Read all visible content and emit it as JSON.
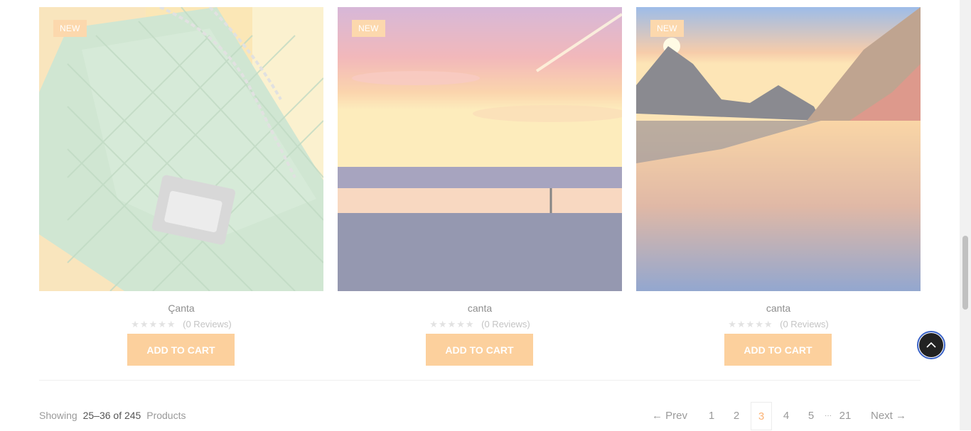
{
  "products": [
    {
      "badge": "NEW",
      "name": "Çanta",
      "reviews": "(0 Reviews)",
      "cart_label": "ADD TO CART",
      "image": "green-quilted-bag"
    },
    {
      "badge": "NEW",
      "name": "canta",
      "reviews": "(0 Reviews)",
      "cart_label": "ADD TO CART",
      "image": "sunset-sea"
    },
    {
      "badge": "NEW",
      "name": "canta",
      "reviews": "(0 Reviews)",
      "cart_label": "ADD TO CART",
      "image": "mountain-lake-sunset"
    }
  ],
  "stars": "★★★★★",
  "showing": {
    "prefix": "Showing",
    "range": "25–36 of 245",
    "suffix": "Products"
  },
  "pagination": {
    "prev": "← Prev",
    "pages": [
      "1",
      "2",
      "3",
      "4",
      "5"
    ],
    "ellipsis": "···",
    "last": "21",
    "next": "Next →",
    "active": "3"
  },
  "colors": {
    "accent": "#fcb375",
    "badge": "#fcd8ad",
    "cart": "#fcd09d"
  },
  "icons": {
    "scroll_top": "chevron-up-icon",
    "star": "star-icon"
  }
}
